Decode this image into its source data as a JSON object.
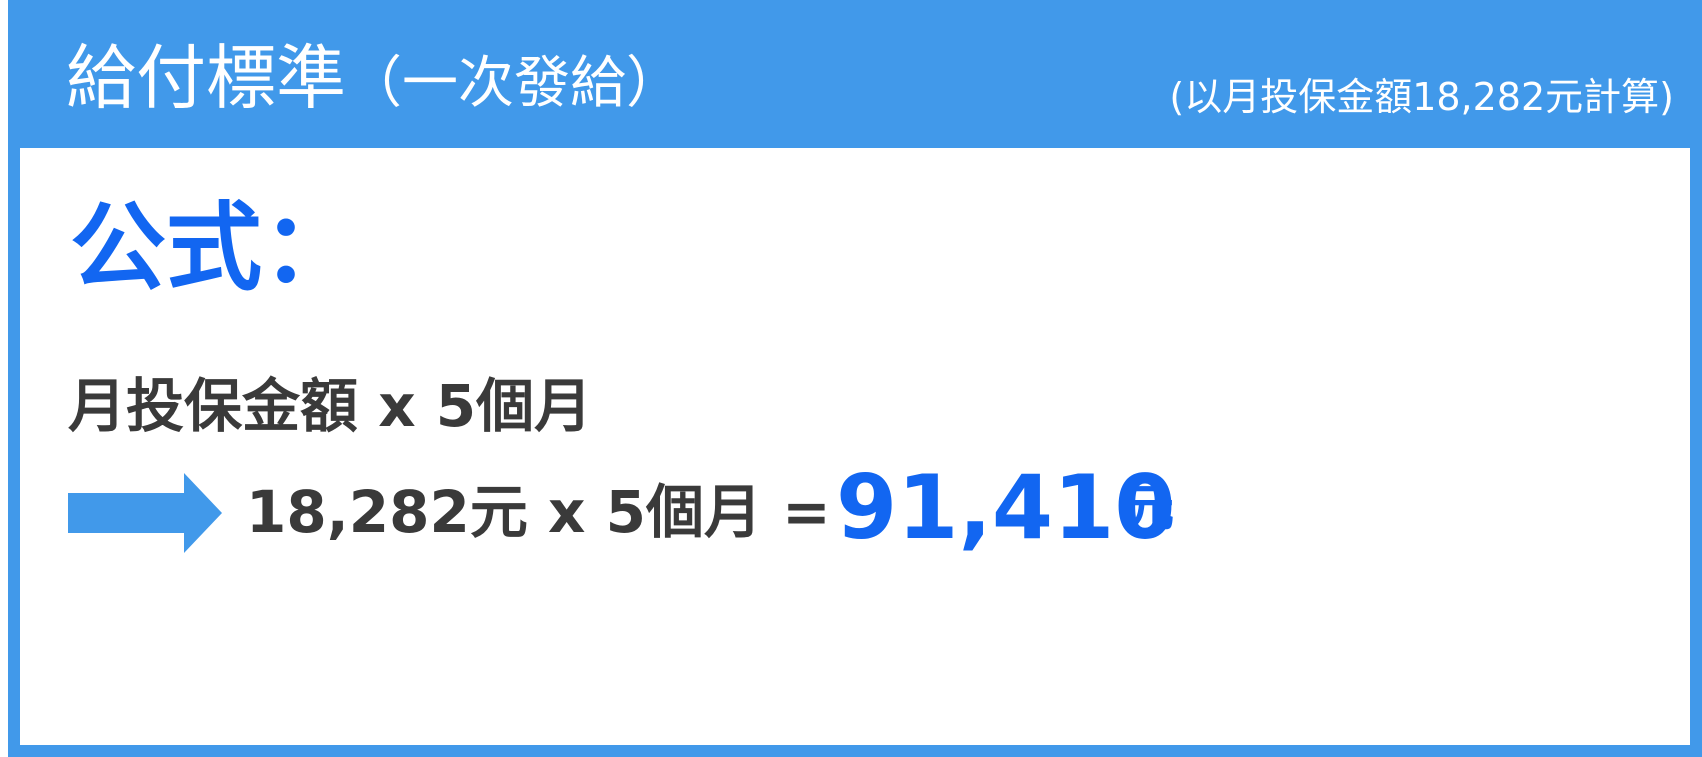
{
  "header": {
    "title": "給付標準",
    "title_sub": "（一次發給）",
    "note": "(以月投保金額18,282元計算)"
  },
  "formula": {
    "label": "公式：",
    "expression": "月投保金額 x 5個月",
    "calculation": "18,282元 x 5個月 =",
    "result_value": "91,410",
    "result_unit": "元",
    "arrow_icon": "right-arrow-icon"
  },
  "colors": {
    "header_bg": "#4199ea",
    "accent_blue": "#1266f1",
    "text_dark": "#3a3a3a"
  }
}
